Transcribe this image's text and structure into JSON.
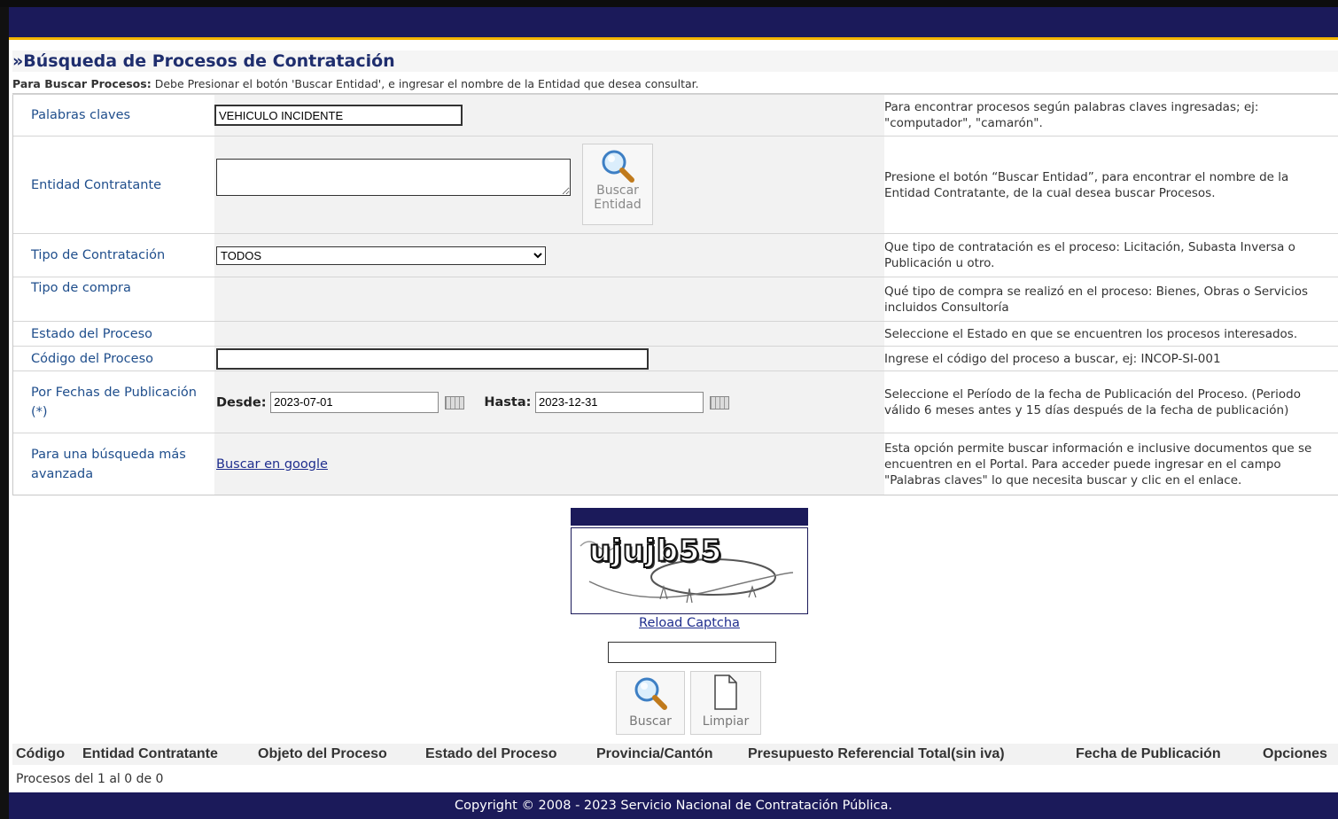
{
  "page": {
    "title": "»Búsqueda de Procesos de Contratación",
    "instructions_bold": "Para Buscar Procesos:",
    "instructions_text": " Debe Presionar el botón 'Buscar Entidad', e ingresar el nombre de la Entidad que desea consultar."
  },
  "form": {
    "keywords": {
      "label": "Palabras claves",
      "value": "VEHICULO INCIDENTE",
      "help": "Para encontrar procesos según palabras claves ingresadas; ej: \"computador\", \"camarón\"."
    },
    "entity": {
      "label": "Entidad Contratante",
      "value": "",
      "button_line1": "Buscar",
      "button_line2": "Entidad",
      "help": "Presione el botón “Buscar Entidad”, para encontrar el nombre de la Entidad Contratante, de la cual desea buscar Procesos."
    },
    "contract_type": {
      "label": "Tipo de Contratación",
      "selected": "TODOS",
      "help": "Que tipo de contratación es el proceso: Licitación, Subasta Inversa o Publicación u otro."
    },
    "purchase_type": {
      "label": "Tipo de compra",
      "help": "Qué tipo de compra se realizó en el proceso: Bienes, Obras o Servicios incluidos Consultoría"
    },
    "process_state": {
      "label": "Estado del Proceso",
      "help": "Seleccione el Estado en que se encuentren los procesos interesados."
    },
    "process_code": {
      "label": "Código del Proceso",
      "value": "",
      "help": "Ingrese el código del proceso a buscar, ej: INCOP-SI-001"
    },
    "dates": {
      "label": "Por Fechas de Publicación (*)",
      "from_label": "Desde:",
      "from_value": "2023-07-01",
      "to_label": "Hasta:",
      "to_value": "2023-12-31",
      "help": "Seleccione el Período de la fecha de Publicación del Proceso. (Periodo válido 6 meses antes y 15 días después de la fecha de publicación)"
    },
    "advanced": {
      "label": "Para una búsqueda más avanzada",
      "link": "Buscar en google",
      "help": "Esta opción permite buscar información e inclusive documentos que se encuentren en el Portal. Para acceder puede ingresar en el campo \"Palabras claves\" lo que necesita buscar y clic en el enlace."
    }
  },
  "captcha": {
    "text": "ujujb55",
    "reload": "Reload Captcha",
    "input_value": ""
  },
  "actions": {
    "search": "Buscar",
    "clear": "Limpiar"
  },
  "results": {
    "columns": [
      "Código",
      "Entidad Contratante",
      "Objeto del Proceso",
      "Estado del Proceso",
      "Provincia/Cantón",
      "Presupuesto Referencial Total(sin iva)",
      "Fecha de Publicación",
      "Opciones"
    ],
    "count_text": "Procesos del 1 al 0 de 0"
  },
  "footer": {
    "copyright": "Copyright © 2008 - 2023 Servicio Nacional de Contratación Pública."
  },
  "colors": {
    "navy": "#1b1a5a",
    "accent": "#f2b400",
    "label_blue": "#1f4e8c"
  }
}
